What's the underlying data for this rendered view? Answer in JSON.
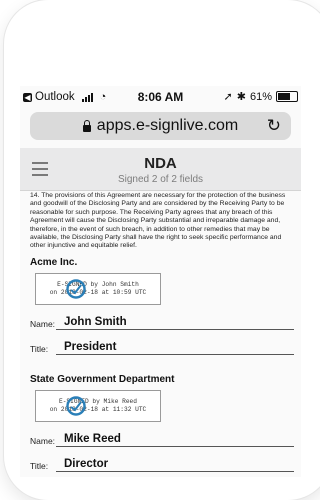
{
  "status_bar": {
    "back_app": "Outlook",
    "time": "8:06 AM",
    "battery": "61%",
    "battery_level": 0.61
  },
  "browser": {
    "url": "apps.e-signlive.com"
  },
  "header": {
    "title": "NDA",
    "subtitle": "Signed 2 of 2 fields"
  },
  "document": {
    "clause": "14.   The provisions of this Agreement are necessary for the protection of the business and goodwill of the Disclosing Party and are considered by the Receiving Party to be reasonable for such purpose. The Receiving Party agrees that any breach of this Agreement will cause the Disclosing Party substantial and irreparable damage and, therefore, in the event of such breach, in addition to other remedies that may be available, the Disclosing Party shall have the right to seek specific performance and other injunctive and equitable relief.",
    "parties": [
      {
        "name": "Acme Inc.",
        "signature_line1": "E-SIGNED by John Smith",
        "signature_line2": "on 2018-02-18 at 10:59 UTC",
        "name_label": "Name:",
        "name_value": "John Smith",
        "title_label": "Title:",
        "title_value": "President"
      },
      {
        "name": "State Government Department",
        "signature_line1": "E-SIGNED by Mike Reed",
        "signature_line2": "on 2018-02-18 at 11:32 UTC",
        "name_label": "Name:",
        "name_value": "Mike Reed",
        "title_label": "Title:",
        "title_value": "Director"
      }
    ]
  },
  "colors": {
    "seal_blue": "#2a7fb8"
  }
}
